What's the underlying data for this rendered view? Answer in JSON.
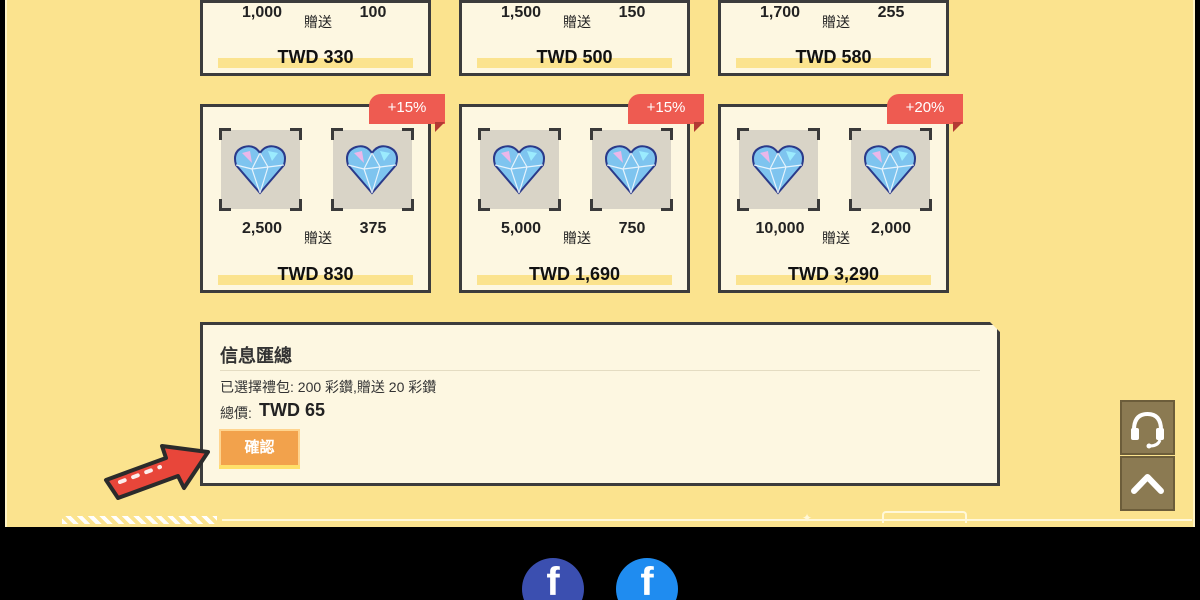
{
  "colors": {
    "panel": "#fbe38e",
    "card": "#fdf7e1",
    "ribbon": "#ee5b51",
    "confirm": "#f2a24c",
    "side_button": "#8b7a52",
    "fb_left": "#3b4fb0",
    "fb_right": "#1f8cf0"
  },
  "packages_top": [
    {
      "base": "1,000",
      "gift_label": "贈送",
      "bonus": "100",
      "price": "TWD 330"
    },
    {
      "base": "1,500",
      "gift_label": "贈送",
      "bonus": "150",
      "price": "TWD 500"
    },
    {
      "base": "1,700",
      "gift_label": "贈送",
      "bonus": "255",
      "price": "TWD 580"
    }
  ],
  "packages": [
    {
      "badge": "+15%",
      "base": "2,500",
      "gift_label": "贈送",
      "bonus": "375",
      "price": "TWD 830"
    },
    {
      "badge": "+15%",
      "base": "5,000",
      "gift_label": "贈送",
      "bonus": "750",
      "price": "TWD 1,690"
    },
    {
      "badge": "+20%",
      "base": "10,000",
      "gift_label": "贈送",
      "bonus": "2,000",
      "price": "TWD 3,290"
    }
  ],
  "summary": {
    "title": "信息匯總",
    "selected": "已選擇禮包: 200 彩鑽,贈送 20 彩鑽",
    "total_label": "總價:",
    "total_value": "TWD 65",
    "confirm_label": "確認"
  },
  "icons": {
    "gem": "heart-diamond-icon",
    "support": "headset-icon",
    "back_to_top": "chevron-up-icon",
    "social": "facebook-icon",
    "pointer": "arrow-pointer-icon"
  }
}
